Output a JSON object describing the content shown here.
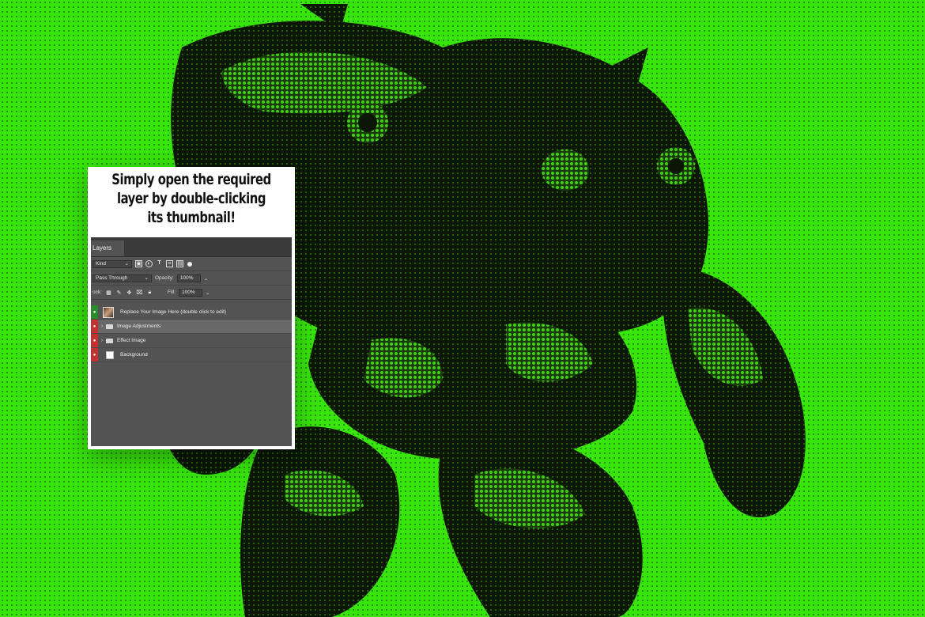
{
  "caption": {
    "line1": "Simply open the required",
    "line2": "layer by double-clicking",
    "line3": "its thumbnail!"
  },
  "panel": {
    "tab_label": "Layers",
    "filter_kind": "Kind",
    "filter_icons": [
      "image-filter-icon",
      "adjustment-filter-icon",
      "type-filter-icon",
      "shape-filter-icon",
      "smart-object-filter-icon"
    ],
    "blend_mode": "Pass Through",
    "opacity_label": "Opacity:",
    "opacity_value": "100%",
    "lock_label": "ock:",
    "fill_label": "Fill:",
    "fill_value": "100%",
    "layers": [
      {
        "name": "Replace Your Image Here (double click to edit)",
        "type": "smart-object",
        "visibility_color": "green"
      },
      {
        "name": "Image Adjustments",
        "type": "group",
        "visibility_color": "red",
        "selected": true
      },
      {
        "name": "Effect Image",
        "type": "group",
        "visibility_color": "red"
      },
      {
        "name": "Background",
        "type": "background",
        "visibility_color": "red"
      }
    ]
  },
  "colors": {
    "background": "#38e60b",
    "robot_dark": "#0b1606",
    "panel_bg": "#535353"
  }
}
